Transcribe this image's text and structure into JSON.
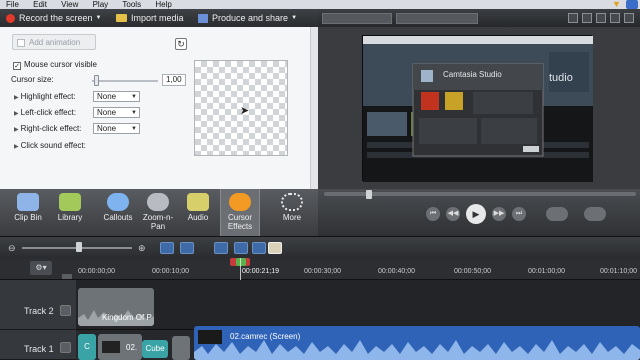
{
  "menu": [
    "File",
    "Edit",
    "View",
    "Play",
    "Tools",
    "Help"
  ],
  "toolbar": {
    "record": "Record the screen",
    "import": "Import media",
    "produce": "Produce and share"
  },
  "props": {
    "add_animation": "Add animation",
    "mouse_visible_label": "Mouse cursor visible",
    "mouse_visible_checked": true,
    "cursor_size_label": "Cursor size:",
    "cursor_size_value": "1,00",
    "highlight_label": "Highlight effect:",
    "highlight_value": "None",
    "left_click_label": "Left-click effect:",
    "left_click_value": "None",
    "right_click_label": "Right-click effect:",
    "right_click_value": "None",
    "click_sound_label": "Click sound effect:"
  },
  "screen_window": {
    "title": "Camtasia Studio",
    "brand_partial": "tudio"
  },
  "tools": [
    {
      "label": "Clip Bin",
      "color": "#8fb4e8"
    },
    {
      "label": "Library",
      "color": "#a3c95a"
    },
    {
      "label": "Callouts",
      "color": "#7fb3ef"
    },
    {
      "label": "Zoom-n-\nPan",
      "color": "#b8bcc2"
    },
    {
      "label": "Audio",
      "color": "#d7cf6a"
    },
    {
      "label": "Cursor\nEffects",
      "color": "#f29a24"
    },
    {
      "label": "More",
      "color": "#e8e8e8"
    }
  ],
  "ruler": {
    "playhead": "00:00:21;19",
    "ticks": [
      "00:00:00;00",
      "00:00:10;00",
      "00:00:30;00",
      "00:00:40;00",
      "00:00:50;00",
      "00:01:00;00",
      "00:01:10;00"
    ]
  },
  "tracks": [
    {
      "name": "Track 2",
      "clip": "Kingdom Of P"
    },
    {
      "name": "Track 1",
      "clip_c": "C",
      "clip_02": "02.",
      "clip_cube": "Cube",
      "clip_main": "02.camrec (Screen)"
    }
  ]
}
